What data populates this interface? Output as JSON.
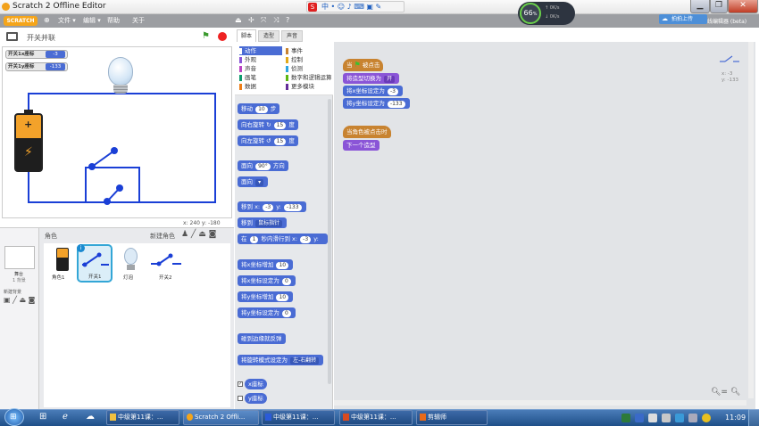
{
  "window": {
    "title": "Scratch 2 Offline Editor"
  },
  "menu": {
    "logo": "SCRATCH",
    "file": "文件",
    "edit": "编辑",
    "help": "帮助",
    "about": "关于"
  },
  "overlay": {
    "perf_percent": "66",
    "perf_unit": "%",
    "net_up": "0K/s",
    "net_down": "0K/s",
    "share_label": "拍拍上传",
    "beta_label": "线编辑器 (beta)"
  },
  "stage": {
    "title": "开关并联",
    "monitors": [
      {
        "label": "开关1x座标",
        "value": "-3"
      },
      {
        "label": "开关1y座标",
        "value": "-133"
      }
    ],
    "coords": {
      "x_label": "x:",
      "x": "240",
      "y_label": "y:",
      "y": "-180"
    }
  },
  "sprites": {
    "header": "角色",
    "new_sprite": "新建角色",
    "stage_label": "舞台",
    "stage_sub": "1 背景",
    "new_backdrop": "新建背景",
    "items": [
      {
        "name": "角色1"
      },
      {
        "name": "开关1"
      },
      {
        "name": "灯泡"
      },
      {
        "name": "开关2"
      }
    ],
    "selected_badge": "i"
  },
  "tabs": {
    "scripts": "脚本",
    "costumes": "造型",
    "sounds": "声音"
  },
  "categories": {
    "left": [
      {
        "label": "动作",
        "color": "#4a6cd4"
      },
      {
        "label": "外观",
        "color": "#8a55d7"
      },
      {
        "label": "声音",
        "color": "#bb42c3"
      },
      {
        "label": "画笔",
        "color": "#0e9a6c"
      },
      {
        "label": "数据",
        "color": "#ee7d16"
      }
    ],
    "right": [
      {
        "label": "事件",
        "color": "#c88330"
      },
      {
        "label": "控制",
        "color": "#e1a91a"
      },
      {
        "label": "侦测",
        "color": "#2ca5e2"
      },
      {
        "label": "数字和逻辑运算",
        "color": "#5cb712"
      },
      {
        "label": "更多模块",
        "color": "#632d99"
      }
    ]
  },
  "palette": {
    "move": {
      "a": "移动",
      "n": "10",
      "b": "步"
    },
    "turn_right": {
      "a": "向右旋转",
      "n": "15",
      "b": "度"
    },
    "turn_left": {
      "a": "向左旋转",
      "n": "15",
      "b": "度"
    },
    "point_dir": {
      "a": "面向",
      "n": "90°",
      "b": "方向"
    },
    "point_to": {
      "a": "面向"
    },
    "goto_xy": {
      "a": "移到 x:",
      "x": "-3",
      "b": "y:",
      "y": "-133"
    },
    "goto": {
      "a": "移到",
      "d": "鼠标指针"
    },
    "glide": {
      "a": "在",
      "n": "1",
      "b": "秒内滑行到 x:",
      "x": "-3",
      "c": "y:"
    },
    "change_x": {
      "a": "将x坐标增加",
      "n": "10"
    },
    "set_x": {
      "a": "将x坐标设定为",
      "n": "0"
    },
    "change_y": {
      "a": "将y坐标增加",
      "n": "10"
    },
    "set_y": {
      "a": "将y坐标设定为",
      "n": "0"
    },
    "bounce": {
      "a": "碰到边缘就反弹"
    },
    "rotation": {
      "a": "将旋转模式设定为",
      "d": "左-右翻转"
    },
    "x_pos": {
      "a": "x座标"
    },
    "y_pos": {
      "a": "y座标"
    }
  },
  "scripts": {
    "flag_hat": {
      "a": "当",
      "b": "被点击"
    },
    "switch_costume": {
      "a": "将造型切换为",
      "d": "开"
    },
    "set_x": {
      "a": "将x坐标设定为",
      "n": "-3"
    },
    "set_y": {
      "a": "将y坐标设定为",
      "n": "-133"
    },
    "click_hat": {
      "a": "当角色被点击时"
    },
    "next_costume": {
      "a": "下一个造型"
    },
    "sprite_info": {
      "x": "x: -3",
      "y": "y: -133"
    }
  },
  "taskbar": {
    "items": [
      {
        "label": "中级第11课：..."
      },
      {
        "label": "Scratch 2 Offli..."
      },
      {
        "label": "中级第11课：..."
      },
      {
        "label": "中级第11课：..."
      },
      {
        "label": "剪辑师"
      }
    ],
    "time": "11:09"
  }
}
